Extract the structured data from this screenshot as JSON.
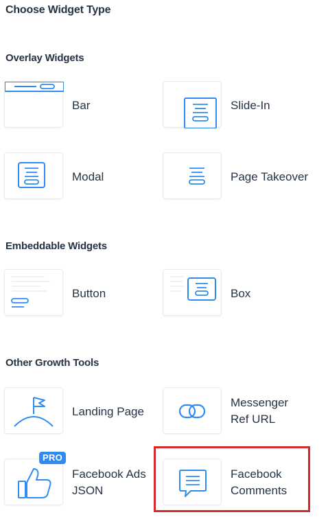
{
  "page_title": "Choose Widget Type",
  "sections": {
    "overlay": {
      "title": "Overlay Widgets",
      "items": [
        {
          "label": "Bar",
          "icon": "bar-icon"
        },
        {
          "label": "Slide-In",
          "icon": "slide-in-icon"
        },
        {
          "label": "Modal",
          "icon": "modal-icon"
        },
        {
          "label": "Page Takeover",
          "icon": "page-takeover-icon"
        }
      ]
    },
    "embeddable": {
      "title": "Embeddable Widgets",
      "items": [
        {
          "label": "Button",
          "icon": "button-icon"
        },
        {
          "label": "Box",
          "icon": "box-icon"
        }
      ]
    },
    "growth": {
      "title": "Other Growth Tools",
      "items": [
        {
          "label": "Landing Page",
          "icon": "flag-icon"
        },
        {
          "label_lines": [
            "Messenger",
            "Ref URL"
          ],
          "icon": "link-icon"
        },
        {
          "label_lines": [
            "Facebook Ads",
            "JSON"
          ],
          "icon": "thumbs-up-icon",
          "badge": "PRO"
        },
        {
          "label_lines": [
            "Facebook",
            "Comments"
          ],
          "icon": "comment-icon",
          "highlighted": true
        }
      ]
    }
  },
  "colors": {
    "accent": "#2e8bf0",
    "text": "#253344",
    "highlight_border": "#d62b2b",
    "tile_border": "#e7ecf1"
  }
}
